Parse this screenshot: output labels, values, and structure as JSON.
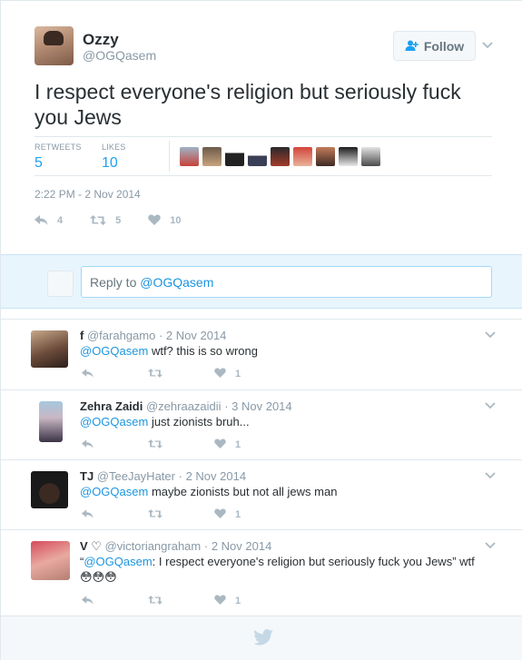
{
  "tweet": {
    "name": "Ozzy",
    "handle": "@OGQasem",
    "follow_label": "Follow",
    "text": "I respect everyone's religion but seriously fuck you Jews",
    "retweets_label": "RETWEETS",
    "retweets": "5",
    "likes_label": "LIKES",
    "likes": "10",
    "timestamp": "2:22 PM - 2 Nov 2014",
    "reply_count": "4",
    "retweet_count": "5",
    "like_count": "10"
  },
  "reply_box": {
    "prefix": "Reply to ",
    "mention": "@OGQasem"
  },
  "replies": [
    {
      "name": "f",
      "handle": "@farahgamo",
      "date": "2 Nov 2014",
      "mention": "@OGQasem",
      "text": " wtf? this is so wrong",
      "likes": "1"
    },
    {
      "name": "Zehra Zaidi",
      "handle": "@zehraazaidii",
      "date": "3 Nov 2014",
      "mention": "@OGQasem",
      "text": " just zionists bruh...",
      "likes": "1"
    },
    {
      "name": "TJ",
      "handle": "@TeeJayHater",
      "date": "2 Nov 2014",
      "mention": "@OGQasem",
      "text": " maybe zionists but not all jews man",
      "likes": "1"
    },
    {
      "name": "V ♡",
      "handle": "@victoriangraham",
      "date": "2 Nov 2014",
      "quote_open": "“",
      "mention": "@OGQasem",
      "text": ": I respect everyone's religion but seriously fuck you Jews” wtf 😳😳😳",
      "likes": "1"
    }
  ],
  "colors": {
    "accent": "#1da1f2",
    "mention": "#1b95e0",
    "muted": "#8899a6",
    "reply_bg": "#e8f5fd"
  },
  "icons": [
    "follow-person-plus-icon",
    "chevron-down-icon",
    "reply-arrow-icon",
    "retweet-icon",
    "heart-icon",
    "twitter-bird-icon"
  ]
}
